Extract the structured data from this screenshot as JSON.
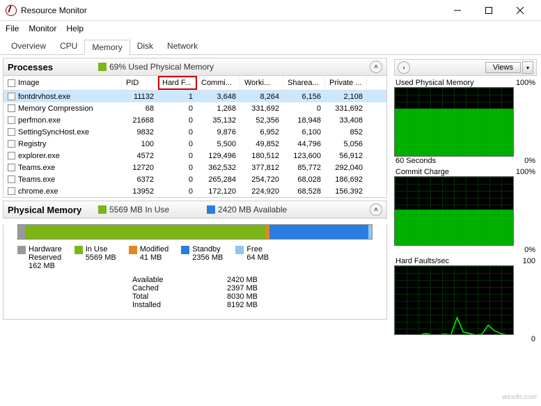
{
  "window": {
    "title": "Resource Monitor"
  },
  "menu": {
    "file": "File",
    "monitor": "Monitor",
    "help": "Help"
  },
  "tabs": [
    "Overview",
    "CPU",
    "Memory",
    "Disk",
    "Network"
  ],
  "active_tab": "Memory",
  "processes": {
    "title": "Processes",
    "legend_color": "#7cb518",
    "legend_text": "69% Used Physical Memory",
    "columns": {
      "image": "Image",
      "pid": "PID",
      "hard": "Hard F...",
      "commit": "Commi...",
      "working": "Worki...",
      "sharea": "Sharea...",
      "private": "Private ..."
    },
    "rows": [
      {
        "image": "fontdrvhost.exe",
        "pid": "11132",
        "hard": "1",
        "commit": "3,648",
        "working": "8,264",
        "sharea": "6,156",
        "private": "2,108",
        "selected": true
      },
      {
        "image": "Memory Compression",
        "pid": "68",
        "hard": "0",
        "commit": "1,268",
        "working": "331,692",
        "sharea": "0",
        "private": "331,692"
      },
      {
        "image": "perfmon.exe",
        "pid": "21668",
        "hard": "0",
        "commit": "35,132",
        "working": "52,356",
        "sharea": "18,948",
        "private": "33,408"
      },
      {
        "image": "SettingSyncHost.exe",
        "pid": "9832",
        "hard": "0",
        "commit": "9,876",
        "working": "6,952",
        "sharea": "6,100",
        "private": "852"
      },
      {
        "image": "Registry",
        "pid": "100",
        "hard": "0",
        "commit": "5,500",
        "working": "49,852",
        "sharea": "44,796",
        "private": "5,056"
      },
      {
        "image": "explorer.exe",
        "pid": "4572",
        "hard": "0",
        "commit": "129,496",
        "working": "180,512",
        "sharea": "123,600",
        "private": "56,912"
      },
      {
        "image": "Teams.exe",
        "pid": "12720",
        "hard": "0",
        "commit": "362,532",
        "working": "377,812",
        "sharea": "85,772",
        "private": "292,040"
      },
      {
        "image": "Teams.exe",
        "pid": "6372",
        "hard": "0",
        "commit": "265,284",
        "working": "254,720",
        "sharea": "68,028",
        "private": "186,692"
      },
      {
        "image": "chrome.exe",
        "pid": "13952",
        "hard": "0",
        "commit": "172,120",
        "working": "224,920",
        "sharea": "68,528",
        "private": "156,392"
      }
    ]
  },
  "phys": {
    "title": "Physical Memory",
    "inuse": {
      "color": "#7cb518",
      "label": "5569 MB In Use"
    },
    "avail": {
      "color": "#2a7de1",
      "label": "2420 MB Available"
    },
    "bar": {
      "hw_pct": 2,
      "inuse_pct": 68,
      "mod_pct": 1,
      "standby_pct": 28,
      "free_pct": 1
    },
    "legend": {
      "hw": {
        "label": "Hardware",
        "sub": "Reserved",
        "val": "162 MB",
        "color": "#9a9a9a"
      },
      "inuse": {
        "label": "In Use",
        "val": "5569 MB",
        "color": "#7cb518"
      },
      "mod": {
        "label": "Modified",
        "val": "41 MB",
        "color": "#e08a1e"
      },
      "standby": {
        "label": "Standby",
        "val": "2356 MB",
        "color": "#2a7de1"
      },
      "free": {
        "label": "Free",
        "val": "64 MB",
        "color": "#8fc4f4"
      }
    },
    "stats": {
      "available": {
        "k": "Available",
        "v": "2420 MB"
      },
      "cached": {
        "k": "Cached",
        "v": "2397 MB"
      },
      "total": {
        "k": "Total",
        "v": "8030 MB"
      },
      "installed": {
        "k": "Installed",
        "v": "8192 MB"
      }
    }
  },
  "right": {
    "views": "Views",
    "chart1": {
      "title": "Used Physical Memory",
      "max": "100%",
      "sub1": "60 Seconds",
      "sub2": "0%",
      "fill_pct": 69
    },
    "chart2": {
      "title": "Commit Charge",
      "max": "100%",
      "sub2": "0%",
      "fill_pct": 52
    },
    "chart3": {
      "title": "Hard Faults/sec",
      "max": "100",
      "sub2": "0"
    }
  },
  "chart_data": [
    {
      "type": "area",
      "title": "Used Physical Memory",
      "ylabel": "%",
      "ylim": [
        0,
        100
      ],
      "x": "60 Seconds",
      "values": [
        69,
        69,
        69,
        69,
        69,
        69,
        69,
        69,
        69,
        69,
        69,
        69
      ]
    },
    {
      "type": "area",
      "title": "Commit Charge",
      "ylabel": "%",
      "ylim": [
        0,
        100
      ],
      "x": "60 Seconds",
      "values": [
        52,
        52,
        52,
        52,
        52,
        52,
        52,
        52,
        52,
        52,
        52,
        52
      ]
    },
    {
      "type": "line",
      "title": "Hard Faults/sec",
      "ylim": [
        0,
        100
      ],
      "x": "60 Seconds",
      "values": [
        0,
        0,
        0,
        0,
        0,
        2,
        0,
        0,
        1,
        0,
        25,
        4,
        2,
        0,
        1,
        14,
        6,
        2,
        0,
        0
      ]
    }
  ],
  "watermark": "wsxdn.com"
}
